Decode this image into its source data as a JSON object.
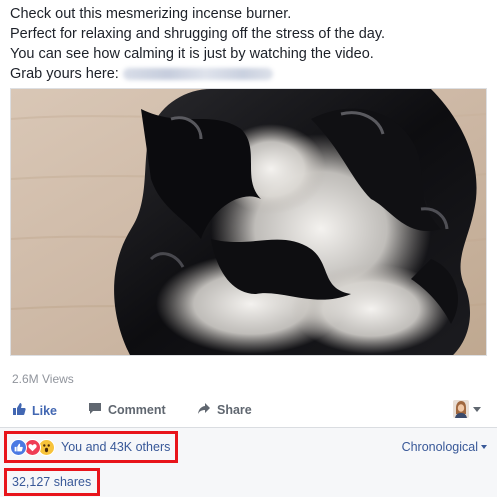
{
  "post": {
    "text_lines": [
      "Check out this mesmerizing incense burner.",
      "Perfect for relaxing and shrugging off the stress of the day.",
      "You can see how calming it is just by watching the video.",
      "Grab yours here:"
    ]
  },
  "video": {
    "views": "2.6M Views"
  },
  "actions": {
    "like": "Like",
    "comment": "Comment",
    "share": "Share"
  },
  "reactions": {
    "icons": [
      "like-icon",
      "love-icon",
      "wow-icon"
    ],
    "summary": "You and 43K others",
    "sort": "Chronological"
  },
  "shares": {
    "text": "32,127 shares"
  },
  "colors": {
    "accent": "#4267b2",
    "link": "#385898",
    "highlight_box": "#e8141b"
  }
}
